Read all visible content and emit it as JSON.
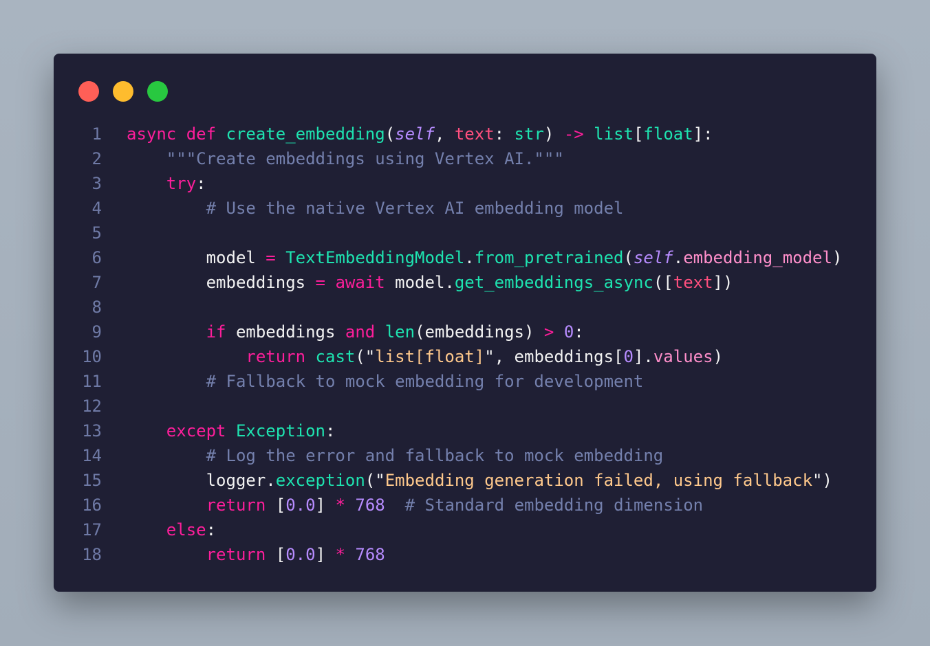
{
  "window": {
    "controls": [
      {
        "name": "close",
        "color": "#ff5f57"
      },
      {
        "name": "minimize",
        "color": "#febc2e"
      },
      {
        "name": "maximize",
        "color": "#28c840"
      }
    ]
  },
  "code": {
    "language": "python",
    "lines": [
      [
        [
          "kw",
          "async "
        ],
        [
          "kw",
          "def "
        ],
        [
          "fn",
          "create_embedding"
        ],
        [
          "p",
          "("
        ],
        [
          "self",
          "self"
        ],
        [
          "p",
          ", "
        ],
        [
          "param",
          "text"
        ],
        [
          "p",
          ": "
        ],
        [
          "fn",
          "str"
        ],
        [
          "p",
          ") "
        ],
        [
          "op",
          "->"
        ],
        [
          "p",
          " "
        ],
        [
          "fn",
          "list"
        ],
        [
          "p",
          "["
        ],
        [
          "fn",
          "float"
        ],
        [
          "p",
          "]:"
        ]
      ],
      [
        [
          "p",
          "    "
        ],
        [
          "doc",
          "\"\"\"Create embeddings using Vertex AI.\"\"\""
        ]
      ],
      [
        [
          "p",
          "    "
        ],
        [
          "kw",
          "try"
        ],
        [
          "p",
          ":"
        ]
      ],
      [
        [
          "p",
          "        "
        ],
        [
          "cm",
          "# Use the native Vertex AI embedding model"
        ]
      ],
      [],
      [
        [
          "p",
          "        model "
        ],
        [
          "op",
          "="
        ],
        [
          "p",
          " "
        ],
        [
          "fn",
          "TextEmbeddingModel"
        ],
        [
          "p",
          "."
        ],
        [
          "fn",
          "from_pretrained"
        ],
        [
          "p",
          "("
        ],
        [
          "self",
          "self"
        ],
        [
          "p",
          "."
        ],
        [
          "attr",
          "embedding_model"
        ],
        [
          "p",
          ")"
        ]
      ],
      [
        [
          "p",
          "        embeddings "
        ],
        [
          "op",
          "="
        ],
        [
          "p",
          " "
        ],
        [
          "kw",
          "await"
        ],
        [
          "p",
          " model."
        ],
        [
          "fn",
          "get_embeddings_async"
        ],
        [
          "p",
          "(["
        ],
        [
          "param",
          "text"
        ],
        [
          "p",
          "])"
        ]
      ],
      [],
      [
        [
          "p",
          "        "
        ],
        [
          "kw",
          "if"
        ],
        [
          "p",
          " embeddings "
        ],
        [
          "kw",
          "and"
        ],
        [
          "p",
          " "
        ],
        [
          "fn",
          "len"
        ],
        [
          "p",
          "(embeddings) "
        ],
        [
          "op",
          ">"
        ],
        [
          "p",
          " "
        ],
        [
          "num",
          "0"
        ],
        [
          "p",
          ":"
        ]
      ],
      [
        [
          "p",
          "            "
        ],
        [
          "kw",
          "return"
        ],
        [
          "p",
          " "
        ],
        [
          "fn",
          "cast"
        ],
        [
          "p",
          "(\""
        ],
        [
          "str",
          "list[float]"
        ],
        [
          "p",
          "\", embeddings["
        ],
        [
          "num",
          "0"
        ],
        [
          "p",
          "]."
        ],
        [
          "attr",
          "values"
        ],
        [
          "p",
          ")"
        ]
      ],
      [
        [
          "p",
          "        "
        ],
        [
          "cm",
          "# Fallback to mock embedding for development"
        ]
      ],
      [],
      [
        [
          "p",
          "    "
        ],
        [
          "kw",
          "except"
        ],
        [
          "p",
          " "
        ],
        [
          "fn",
          "Exception"
        ],
        [
          "p",
          ":"
        ]
      ],
      [
        [
          "p",
          "        "
        ],
        [
          "cm",
          "# Log the error and fallback to mock embedding"
        ]
      ],
      [
        [
          "p",
          "        logger."
        ],
        [
          "fn",
          "exception"
        ],
        [
          "p",
          "(\""
        ],
        [
          "str",
          "Embedding generation failed, using fallback"
        ],
        [
          "p",
          "\")"
        ]
      ],
      [
        [
          "p",
          "        "
        ],
        [
          "kw",
          "return"
        ],
        [
          "p",
          " ["
        ],
        [
          "num",
          "0.0"
        ],
        [
          "p",
          "] "
        ],
        [
          "op",
          "*"
        ],
        [
          "p",
          " "
        ],
        [
          "num",
          "768"
        ],
        [
          "p",
          "  "
        ],
        [
          "cm",
          "# Standard embedding dimension"
        ]
      ],
      [
        [
          "p",
          "    "
        ],
        [
          "kw",
          "else"
        ],
        [
          "p",
          ":"
        ]
      ],
      [
        [
          "p",
          "        "
        ],
        [
          "kw",
          "return"
        ],
        [
          "p",
          " ["
        ],
        [
          "num",
          "0.0"
        ],
        [
          "p",
          "] "
        ],
        [
          "op",
          "*"
        ],
        [
          "p",
          " "
        ],
        [
          "num",
          "768"
        ]
      ]
    ]
  }
}
